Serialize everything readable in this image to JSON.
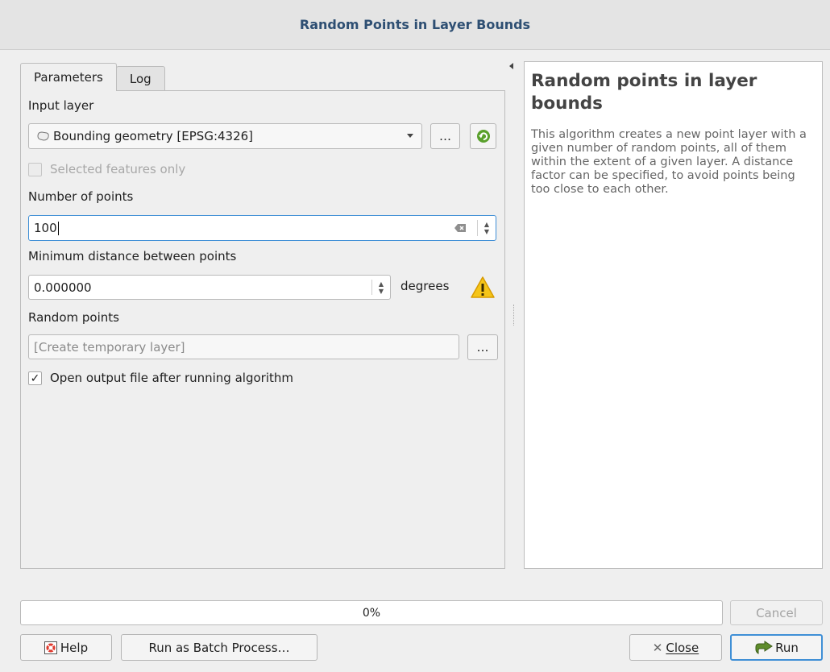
{
  "window": {
    "title": "Random Points in Layer Bounds"
  },
  "tabs": [
    "Parameters",
    "Log"
  ],
  "form": {
    "input_layer_label": "Input layer",
    "input_layer_value": "Bounding geometry [EPSG:4326]",
    "browse_label": "…",
    "selected_only_label": "Selected features only",
    "num_points_label": "Number of points",
    "num_points_value": "100",
    "min_distance_label": "Minimum distance between points",
    "min_distance_value": "0.000000",
    "units": "degrees",
    "random_points_label": "Random points",
    "output_placeholder": "[Create temporary layer]",
    "open_output_label": "Open output file after running algorithm",
    "open_output_checked": "✓"
  },
  "help": {
    "title": "Random points in layer bounds",
    "body": "This algorithm creates a new point layer with a given number of random points, all of them within the extent of a given layer. A distance factor can be specified, to avoid points being too close to each other."
  },
  "progress": {
    "text": "0%",
    "value": 0
  },
  "buttons": {
    "cancel": "Cancel",
    "help": "Help",
    "batch": "Run as Batch Process…",
    "close": "Close",
    "run": "Run"
  },
  "icons": {
    "polygon_layer": "polygon-icon",
    "refresh": "refresh-icon",
    "warning": "warning-icon",
    "clear": "clear-icon",
    "help": "help-icon",
    "close": "close-icon",
    "run": "run-icon",
    "collapse": "collapse-arrow-icon"
  },
  "colors": {
    "title": "#2e4f73",
    "focus": "#3f8fd6",
    "warning": "#f5c518"
  }
}
